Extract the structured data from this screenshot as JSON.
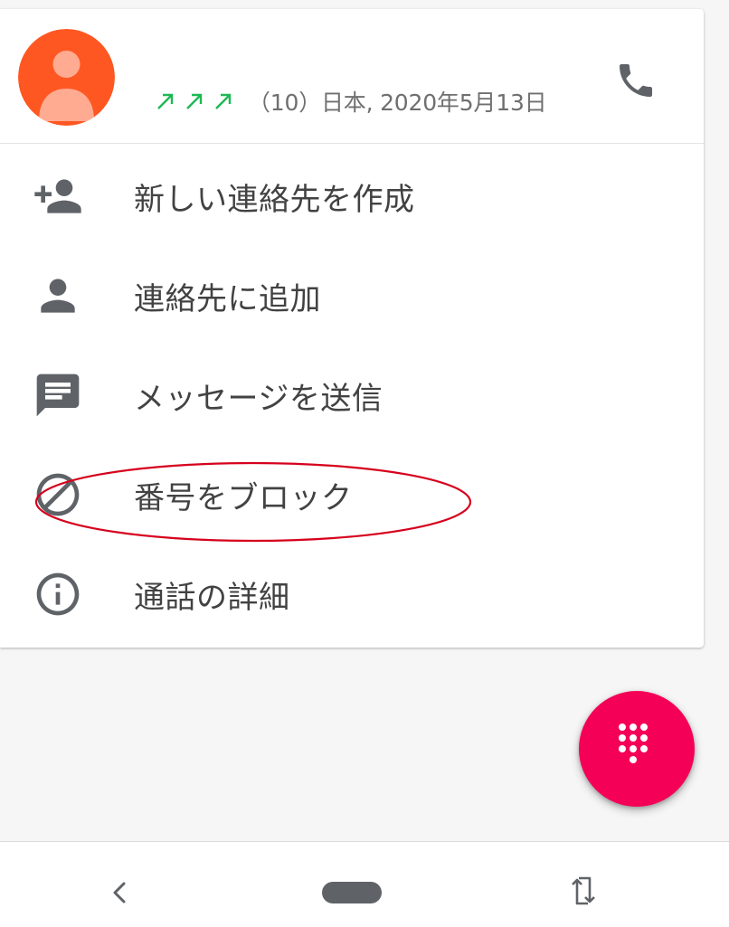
{
  "call_entry": {
    "avatar_icon": "person-avatar-icon",
    "avatar_color": "#ff5722",
    "call_type_icon": "outgoing-call-arrow-icon",
    "call_type_color": "#1db954",
    "call_count_arrows": 3,
    "details": "（10）日本, 2020年5月13日",
    "call_button_icon": "phone-icon"
  },
  "menu": {
    "items": [
      {
        "icon": "person-add-icon",
        "label": "新しい連絡先を作成"
      },
      {
        "icon": "person-icon",
        "label": "連絡先に追加"
      },
      {
        "icon": "message-icon",
        "label": "メッセージを送信"
      },
      {
        "icon": "block-icon",
        "label": "番号をブロック"
      },
      {
        "icon": "info-icon",
        "label": "通話の詳細"
      }
    ],
    "highlighted_item": "番号をブロック",
    "highlight_color": "#d6001c"
  },
  "fab": {
    "icon": "dialpad-icon",
    "color": "#f50057"
  },
  "navigation_bar": {
    "back_icon": "back-chevron-icon",
    "home_icon": "home-pill-icon",
    "rotate_icon": "rotate-screen-icon"
  }
}
